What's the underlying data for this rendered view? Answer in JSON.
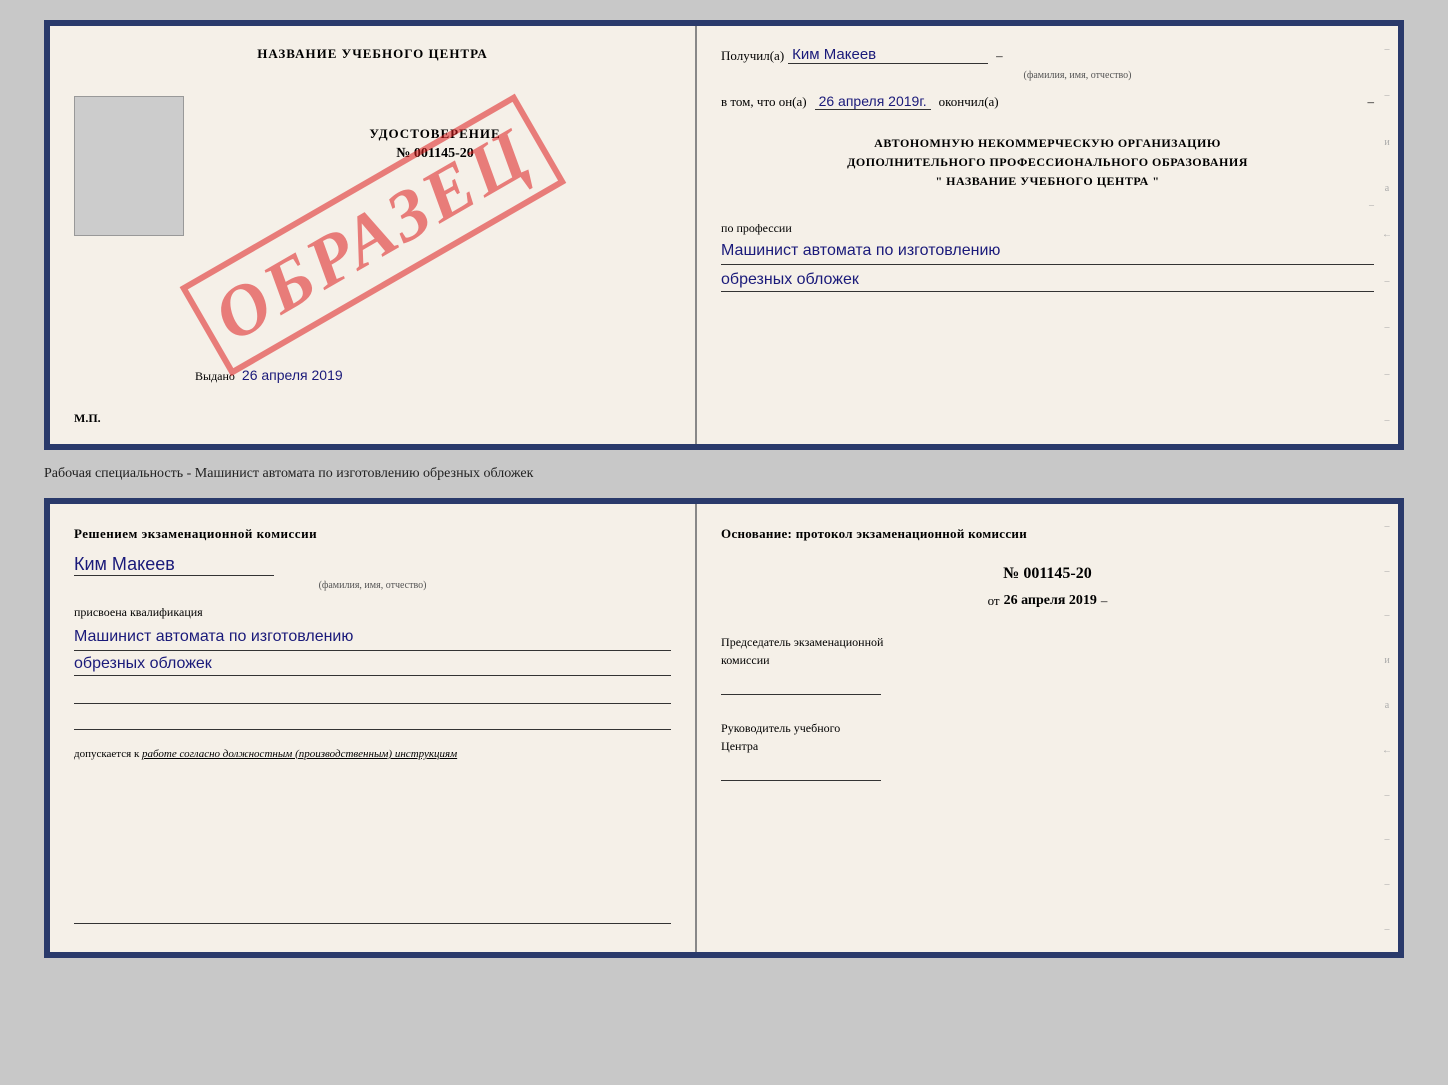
{
  "page": {
    "background": "#c8c8c8"
  },
  "cert_doc": {
    "left": {
      "title": "НАЗВАНИЕ УЧЕБНОГО ЦЕНТРА",
      "photo_alt": "фото",
      "udost_label": "УДОСТОВЕРЕНИЕ",
      "udost_number": "№ 001145-20",
      "vydano_prefix": "Выдано",
      "vydano_date": "26 апреля 2019",
      "mp_label": "М.П.",
      "watermark": "ОБРАЗЕЦ"
    },
    "right": {
      "poluchil_label": "Получил(а)",
      "poluchil_value": "Ким Макеев",
      "fio_sublabel": "(фамилия, имя, отчество)",
      "vtom_label": "в том, что он(а)",
      "vtom_date": "26 апреля 2019г.",
      "okончил_label": "окончил(а)",
      "org_line1": "АВТОНОМНУЮ НЕКОММЕРЧЕСКУЮ ОРГАНИЗАЦИЮ",
      "org_line2": "ДОПОЛНИТЕЛЬНОГО ПРОФЕССИОНАЛЬНОГО ОБРАЗОВАНИЯ",
      "org_line3": "\"   НАЗВАНИЕ УЧЕБНОГО ЦЕНТРА   \"",
      "profession_label": "по профессии",
      "profession_value1": "Машинист автомата по изготовлению",
      "profession_value2": "обрезных обложек"
    }
  },
  "between_text": "Рабочая специальность - Машинист автомата по изготовлению обрезных обложек",
  "exam_doc": {
    "left": {
      "title_line1": "Решением экзаменационной комиссии",
      "name_value": "Ким Макеев",
      "name_sublabel": "(фамилия, имя, отчество)",
      "qualif_label": "присвоена квалификация",
      "qualif_value1": "Машинист автомата по изготовлению",
      "qualif_value2": "обрезных обложек",
      "dopusk_label": "допускается к",
      "dopusk_value": "работе согласно должностным (производственным) инструкциям"
    },
    "right": {
      "title": "Основание: протокол экзаменационной комиссии",
      "number": "№  001145-20",
      "date_prefix": "от",
      "date_value": "26 апреля 2019",
      "chair_label_line1": "Председатель экзаменационной",
      "chair_label_line2": "комиссии",
      "rukov_label_line1": "Руководитель учебного",
      "rukov_label_line2": "Центра"
    }
  },
  "margin_chars": [
    "-",
    "и",
    "а",
    "←",
    "-",
    "-",
    "-",
    "-"
  ]
}
